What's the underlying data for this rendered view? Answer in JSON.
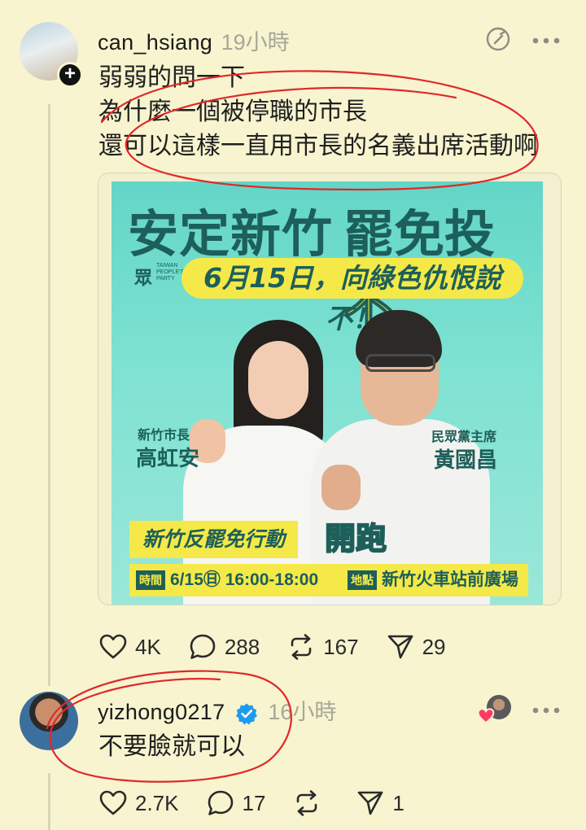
{
  "post": {
    "username": "can_hsiang",
    "time": "19小時",
    "text_lines": [
      "弱弱的問一下",
      "為什麼一個被停職的市長",
      "還可以這樣一直用市長的名義出席活動啊"
    ],
    "poster": {
      "title_left": "安定新竹",
      "title_right": "罷免投",
      "title_neg": "不",
      "logo": "眾",
      "logo_small": "TAIWAN PEOPLE'S PARTY",
      "subtitle": "6月15日，向綠色仇恨說不！",
      "left_role": "新竹市長",
      "left_name": "高虹安",
      "right_role": "民眾黨主席",
      "right_name": "黃國昌",
      "campaign": "新竹反罷免行動",
      "start": "開跑",
      "time_tag": "時間",
      "time_value": "6/15㊐ 16:00-18:00",
      "place_tag": "地點",
      "place_value": "新竹火車站前廣場"
    },
    "actions": {
      "likes": "4K",
      "comments": "288",
      "reposts": "167",
      "shares": "29"
    }
  },
  "reply": {
    "username": "yizhong0217",
    "time": "16小時",
    "text": "不要臉就可以",
    "actions": {
      "likes": "2.7K",
      "comments": "17",
      "reposts": "",
      "shares": "1"
    }
  },
  "icons": [
    "avatar",
    "follow-plus-icon",
    "edit-icon",
    "more-icon",
    "heart-icon",
    "comment-icon",
    "repost-icon",
    "share-icon",
    "verified-badge-icon"
  ],
  "colors": {
    "background": "#f7f4cf",
    "annotation": "#e0282a",
    "verified": "#1d9bf0",
    "poster_teal": "#63d6c7",
    "poster_yellow": "#f4e948"
  }
}
